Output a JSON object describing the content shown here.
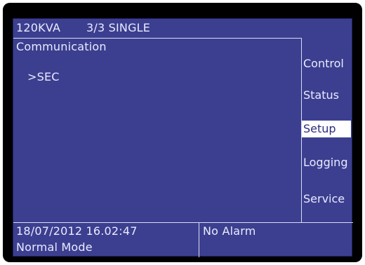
{
  "header": {
    "model": "120KVA",
    "config": "3/3 SINGLE"
  },
  "main": {
    "section_title": "Communication",
    "selected_item": ">SEC"
  },
  "menu": {
    "items": [
      {
        "label": "Control"
      },
      {
        "label": "Status"
      },
      {
        "label": "Setup"
      },
      {
        "label": "Logging"
      },
      {
        "label": "Service"
      }
    ],
    "selected": "Setup"
  },
  "status": {
    "datetime": "18/07/2012  16.02:47",
    "mode": "Normal Mode",
    "alarm": "No Alarm"
  },
  "colors": {
    "screen_background": "#3c3f8f",
    "text": "#e9ebff",
    "selected_background": "#ffffff",
    "selected_text": "#2a2d80"
  }
}
